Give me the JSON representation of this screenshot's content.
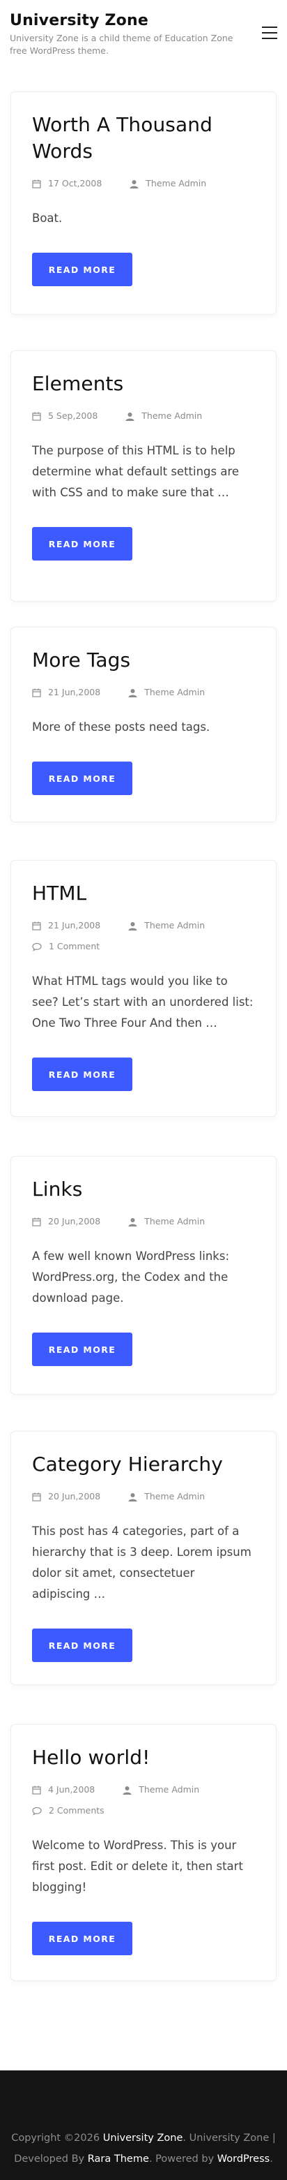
{
  "header": {
    "site_title": "University Zone",
    "site_description": "University Zone is a child theme of Education Zone free WordPress theme."
  },
  "posts": [
    {
      "title": "Worth A Thousand Words",
      "date": "17 Oct,2008",
      "author": "Theme Admin",
      "comments": "",
      "excerpt": "Boat.",
      "read_more": "READ MORE"
    },
    {
      "title": "Elements",
      "date": "5 Sep,2008",
      "author": "Theme Admin",
      "comments": "",
      "excerpt": "The purpose of this HTML is to help determine what default settings are with CSS and to make sure that …",
      "read_more": "READ MORE"
    },
    {
      "title": "More Tags",
      "date": "21 Jun,2008",
      "author": "Theme Admin",
      "comments": "",
      "excerpt": "More of these posts need tags.",
      "read_more": "READ MORE"
    },
    {
      "title": "HTML",
      "date": "21 Jun,2008",
      "author": "Theme Admin",
      "comments": "1 Comment",
      "excerpt": "What HTML tags would you like to see? Let’s start with an unordered list: One Two Three Four And then …",
      "read_more": "READ MORE"
    },
    {
      "title": "Links",
      "date": "20 Jun,2008",
      "author": "Theme Admin",
      "comments": "",
      "excerpt": "A few well known WordPress links: WordPress.org, the Codex and the download page.",
      "read_more": "READ MORE"
    },
    {
      "title": "Category Hierarchy",
      "date": "20 Jun,2008",
      "author": "Theme Admin",
      "comments": "",
      "excerpt": "This post has 4 categories, part of a hierarchy that is 3 deep. Lorem ipsum dolor sit amet, consectetuer adipiscing …",
      "read_more": "READ MORE"
    },
    {
      "title": "Hello world!",
      "date": "4 Jun,2008",
      "author": "Theme Admin",
      "comments": "2 Comments",
      "excerpt": "Welcome to WordPress. This is your first post. Edit or delete it, then start blogging!",
      "read_more": "READ MORE"
    }
  ],
  "footer": {
    "copyright_prefix": "Copyright ©2026 ",
    "site_link": "University Zone",
    "separator_text": ". University Zone | Developed By ",
    "developer_link": "Rara Theme",
    "powered_text": ". Powered by ",
    "wordpress_link": "WordPress",
    "end_text": "."
  },
  "colors": {
    "button_bg": "#3d5afe",
    "footer_bg": "#141414"
  }
}
